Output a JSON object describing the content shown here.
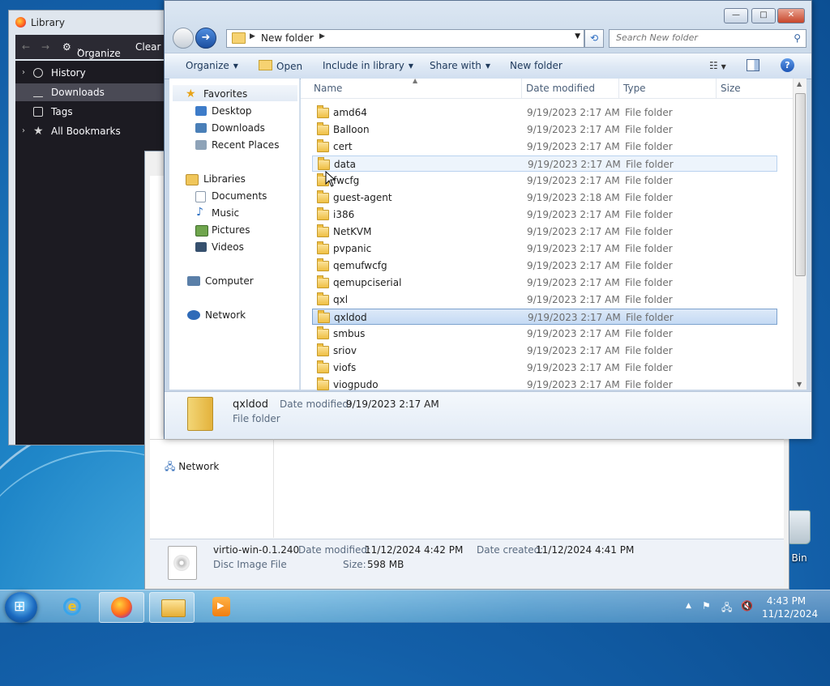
{
  "desktop": {
    "recycle_label": "le Bin",
    "colors": {
      "wallpaper": "#1f86c8",
      "selection": "#c4daf4"
    }
  },
  "library_window": {
    "title": "Library",
    "toolbar": {
      "organize": "Organize",
      "organize_caret": "˅",
      "clear": "Clear",
      "back": "←",
      "forward": "→"
    },
    "items": [
      {
        "arrow": "›",
        "label": "History"
      },
      {
        "arrow": "",
        "label": "Downloads"
      },
      {
        "arrow": "",
        "label": "Tags"
      },
      {
        "arrow": "›",
        "label": "All Bookmarks"
      }
    ]
  },
  "mid_window": {
    "nav_network": "Network",
    "details": {
      "name": "virtio-win-0.1.240",
      "modified_label": "Date modified:",
      "modified_value": "11/12/2024 4:42 PM",
      "created_label": "Date created:",
      "created_value": "11/12/2024 4:41 PM",
      "type": "Disc Image File",
      "size_label": "Size:",
      "size_value": "598 MB"
    }
  },
  "main_window": {
    "buttons": {
      "minimize": "—",
      "maximize": "□",
      "close": "✕"
    },
    "address": {
      "crumb": "New folder",
      "sep": "▶"
    },
    "search_placeholder": "Search New folder",
    "toolbar": {
      "organize": "Organize",
      "open": "Open",
      "include": "Include in library",
      "share": "Share with",
      "new_folder": "New folder",
      "caret": "▼",
      "help": "?"
    },
    "nav": {
      "favorites": "Favorites",
      "desktop": "Desktop",
      "downloads": "Downloads",
      "recent": "Recent Places",
      "libraries": "Libraries",
      "documents": "Documents",
      "music": "Music",
      "pictures": "Pictures",
      "videos": "Videos",
      "computer": "Computer",
      "network": "Network"
    },
    "columns": {
      "name": "Name",
      "date": "Date modified",
      "type": "Type",
      "size": "Size"
    },
    "files": [
      {
        "name": "amd64",
        "date": "9/19/2023 2:17 AM",
        "type": "File folder"
      },
      {
        "name": "Balloon",
        "date": "9/19/2023 2:17 AM",
        "type": "File folder"
      },
      {
        "name": "cert",
        "date": "9/19/2023 2:17 AM",
        "type": "File folder"
      },
      {
        "name": "data",
        "date": "9/19/2023 2:17 AM",
        "type": "File folder"
      },
      {
        "name": "fwcfg",
        "date": "9/19/2023 2:17 AM",
        "type": "File folder"
      },
      {
        "name": "guest-agent",
        "date": "9/19/2023 2:18 AM",
        "type": "File folder"
      },
      {
        "name": "i386",
        "date": "9/19/2023 2:17 AM",
        "type": "File folder"
      },
      {
        "name": "NetKVM",
        "date": "9/19/2023 2:17 AM",
        "type": "File folder"
      },
      {
        "name": "pvpanic",
        "date": "9/19/2023 2:17 AM",
        "type": "File folder"
      },
      {
        "name": "qemufwcfg",
        "date": "9/19/2023 2:17 AM",
        "type": "File folder"
      },
      {
        "name": "qemupciserial",
        "date": "9/19/2023 2:17 AM",
        "type": "File folder"
      },
      {
        "name": "qxl",
        "date": "9/19/2023 2:17 AM",
        "type": "File folder"
      },
      {
        "name": "qxldod",
        "date": "9/19/2023 2:17 AM",
        "type": "File folder"
      },
      {
        "name": "smbus",
        "date": "9/19/2023 2:17 AM",
        "type": "File folder"
      },
      {
        "name": "sriov",
        "date": "9/19/2023 2:17 AM",
        "type": "File folder"
      },
      {
        "name": "viofs",
        "date": "9/19/2023 2:17 AM",
        "type": "File folder"
      },
      {
        "name": "viogpudo",
        "date": "9/19/2023 2:17 AM",
        "type": "File folder"
      }
    ],
    "selected_file": "qxldod",
    "hovered_file": "data",
    "details": {
      "name": "qxldod",
      "modified_label": "Date modified:",
      "modified_value": "9/19/2023 2:17 AM",
      "type": "File folder"
    }
  },
  "taskbar": {
    "clock_time": "4:43 PM",
    "clock_date": "11/12/2024",
    "tray_chevron": "▲"
  }
}
